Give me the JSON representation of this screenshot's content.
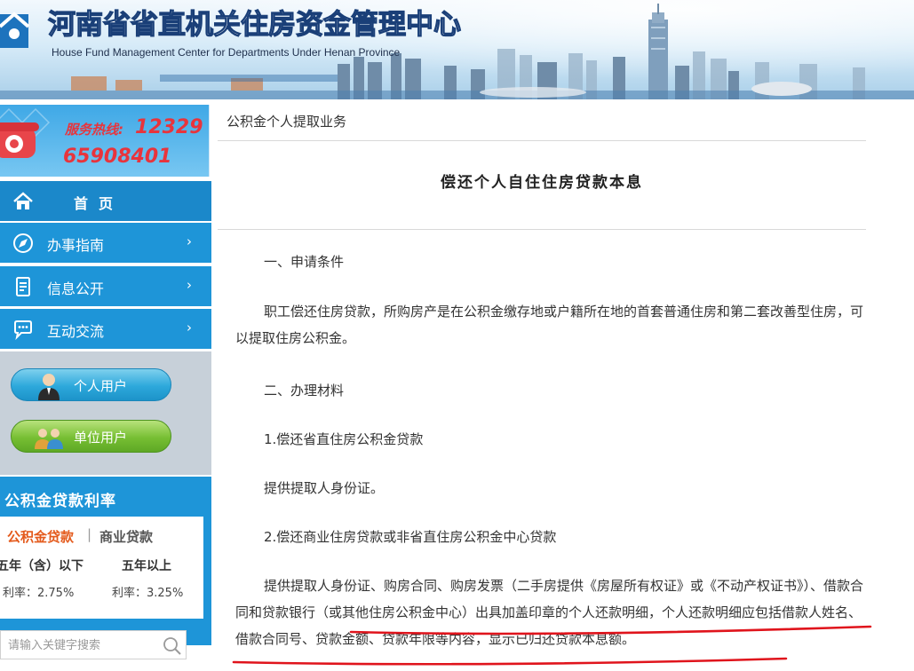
{
  "banner": {
    "title": "河南省省直机关住房资金管理中心",
    "subtitle": "House Fund Management Center for Departments Under Henan Province"
  },
  "hotline": {
    "label": "服务热线:",
    "number1": "12329",
    "number2": "65908401"
  },
  "nav": {
    "items": [
      {
        "label": "首页",
        "icon": "home-icon"
      },
      {
        "label": "办事指南",
        "icon": "compass-icon"
      },
      {
        "label": "信息公开",
        "icon": "document-icon"
      },
      {
        "label": "互动交流",
        "icon": "chat-icon"
      }
    ]
  },
  "users": {
    "personal_label": "个人用户",
    "unit_label": "单位用户"
  },
  "rates": {
    "title": "公积金贷款利率",
    "tab_fund": "公积金贷款",
    "tab_separator": "|",
    "tab_commercial": "商业贷款",
    "col1_head": "五年（含）以下",
    "col2_head": "五年以上",
    "col1_value": "利率：2.75%",
    "col2_value": "利率：3.25%"
  },
  "search": {
    "placeholder": "请输入关键字搜索"
  },
  "main": {
    "breadcrumb": "公积金个人提取业务",
    "title": "偿还个人自住住房贷款本息",
    "paragraphs": {
      "sec1": "一、申请条件",
      "cond": "职工偿还住房贷款，所购房产是在公积金缴存地或户籍所在地的首套普通住房和第二套改善型住房，可以提取住房公积金。",
      "sec2": "二、办理材料",
      "item1": "1.偿还省直住房公积金贷款",
      "item1_body": "提供提取人身份证。",
      "item2": "2.偿还商业住房贷款或非省直住房公积金中心贷款",
      "item2_body": "提供提取人身份证、购房合同、购房发票（二手房提供《房屋所有权证》或《不动产权证书》）、借款合同和贷款银行（或其他住房公积金中心）出具加盖印章的个人还款明细，个人还款明细应包括借款人姓名、借款合同号、贷款金额、贷款年限等内容，显示已归还贷款本息额。"
    }
  },
  "colors": {
    "nav_blue": "#1e95d8",
    "hotline_red": "#e8343c",
    "annotation_red": "#e0141c",
    "rate_tab_active": "#e45a1c"
  }
}
